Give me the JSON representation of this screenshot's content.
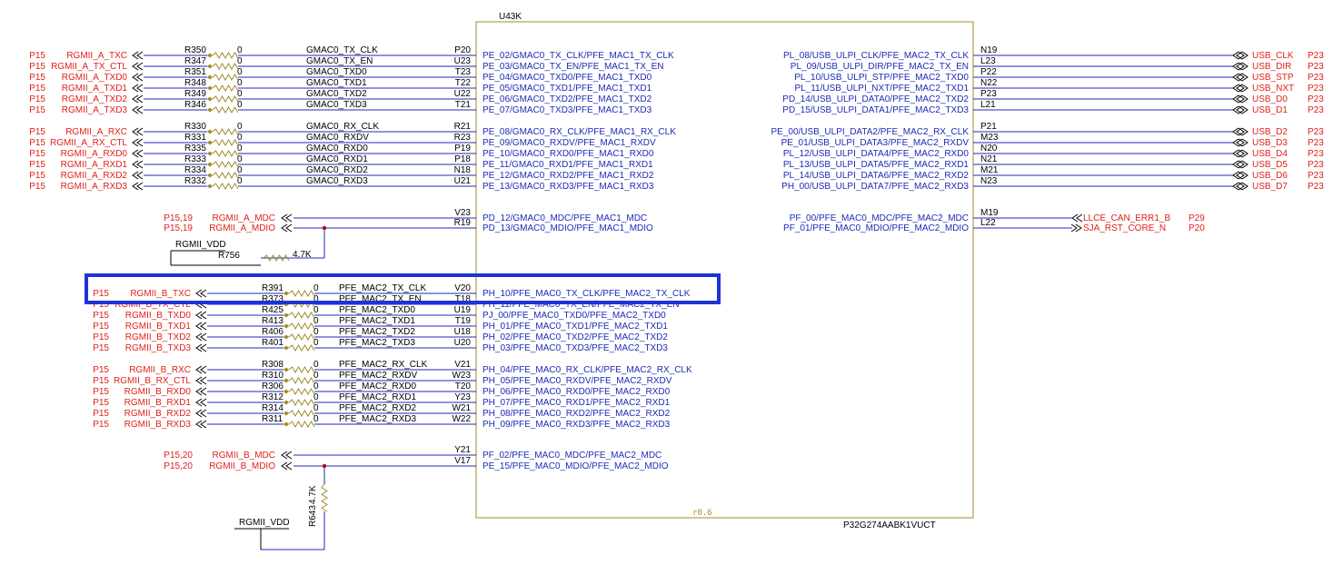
{
  "chip": {
    "ref": "U43K",
    "part": "P32G274AABK1VUCT",
    "rev": "r0.6"
  },
  "colors": {
    "signal": "#e0201a",
    "pin": "#1c2bb5",
    "wire": "#1c2bb5",
    "highlight": "#1d33d8",
    "resistor": "#a08c2a"
  },
  "groups": {
    "rgmii_a": [
      {
        "page": "P15",
        "port": "RGMII_A_TXC",
        "res": "R350",
        "val": "0",
        "net": "GMAC0_TX_CLK",
        "pin": "P20",
        "func": "PE_02/GMAC0_TX_CLK/PFE_MAC1_TX_CLK"
      },
      {
        "page": "P15",
        "port": "RGMII_A_TX_CTL",
        "res": "R347",
        "val": "0",
        "net": "GMAC0_TX_EN",
        "pin": "U23",
        "func": "PE_03/GMAC0_TX_EN/PFE_MAC1_TX_EN"
      },
      {
        "page": "P15",
        "port": "RGMII_A_TXD0",
        "res": "R351",
        "val": "0",
        "net": "GMAC0_TXD0",
        "pin": "T23",
        "func": "PE_04/GMAC0_TXD0/PFE_MAC1_TXD0"
      },
      {
        "page": "P15",
        "port": "RGMII_A_TXD1",
        "res": "R348",
        "val": "0",
        "net": "GMAC0_TXD1",
        "pin": "T22",
        "func": "PE_05/GMAC0_TXD1/PFE_MAC1_TXD1"
      },
      {
        "page": "P15",
        "port": "RGMII_A_TXD2",
        "res": "R349",
        "val": "0",
        "net": "GMAC0_TXD2",
        "pin": "U22",
        "func": "PE_06/GMAC0_TXD2/PFE_MAC1_TXD2"
      },
      {
        "page": "P15",
        "port": "RGMII_A_TXD3",
        "res": "R346",
        "val": "0",
        "net": "GMAC0_TXD3",
        "pin": "T21",
        "func": "PE_07/GMAC0_TXD3/PFE_MAC1_TXD3"
      },
      {
        "page": "P15",
        "port": "RGMII_A_RXC",
        "res": "R330",
        "val": "0",
        "net": "GMAC0_RX_CLK",
        "pin": "R21",
        "func": "PE_08/GMAC0_RX_CLK/PFE_MAC1_RX_CLK"
      },
      {
        "page": "P15",
        "port": "RGMII_A_RX_CTL",
        "res": "R331",
        "val": "0",
        "net": "GMAC0_RXDV",
        "pin": "R23",
        "func": "PE_09/GMAC0_RXDV/PFE_MAC1_RXDV"
      },
      {
        "page": "P15",
        "port": "RGMII_A_RXD0",
        "res": "R335",
        "val": "0",
        "net": "GMAC0_RXD0",
        "pin": "P19",
        "func": "PE_10/GMAC0_RXD0/PFE_MAC1_RXD0"
      },
      {
        "page": "P15",
        "port": "RGMII_A_RXD1",
        "res": "R333",
        "val": "0",
        "net": "GMAC0_RXD1",
        "pin": "P18",
        "func": "PE_11/GMAC0_RXD1/PFE_MAC1_RXD1"
      },
      {
        "page": "P15",
        "port": "RGMII_A_RXD2",
        "res": "R334",
        "val": "0",
        "net": "GMAC0_RXD2",
        "pin": "N18",
        "func": "PE_12/GMAC0_RXD2/PFE_MAC1_RXD2"
      },
      {
        "page": "P15",
        "port": "RGMII_A_RXD3",
        "res": "R332",
        "val": "0",
        "net": "GMAC0_RXD3",
        "pin": "U21",
        "func": "PE_13/GMAC0_RXD3/PFE_MAC1_RXD3"
      }
    ],
    "mdio_a": [
      {
        "page": "P15,19",
        "port": "RGMII_A_MDC",
        "pin": "V23",
        "func": "PD_12/GMAC0_MDC/PFE_MAC1_MDC"
      },
      {
        "page": "P15,19",
        "port": "RGMII_A_MDIO",
        "pin": "R19",
        "func": "PD_13/GMAC0_MDIO/PFE_MAC1_MDIO"
      }
    ],
    "pullup_a": {
      "rail": "RGMII_VDD",
      "res": "R756",
      "val": "4.7K"
    },
    "rgmii_b": [
      {
        "page": "P15",
        "port": "RGMII_B_TXC",
        "res": "R391",
        "val": "0",
        "net": "PFE_MAC2_TX_CLK",
        "pin": "V20",
        "func": "PH_10/PFE_MAC0_TX_CLK/PFE_MAC2_TX_CLK"
      },
      {
        "page": "P15",
        "port": "RGMII_B_TX_CTL",
        "res": "R373",
        "val": "0",
        "net": "PFE_MAC2_TX_EN",
        "pin": "T18",
        "func": "PH_11/PFE_MAC0_TX_EN/PFE_MAC2_TX_EN"
      },
      {
        "page": "P15",
        "port": "RGMII_B_TXD0",
        "res": "R425",
        "val": "0",
        "net": "PFE_MAC2_TXD0",
        "pin": "U19",
        "func": "PJ_00/PFE_MAC0_TXD0/PFE_MAC2_TXD0"
      },
      {
        "page": "P15",
        "port": "RGMII_B_TXD1",
        "res": "R413",
        "val": "0",
        "net": "PFE_MAC2_TXD1",
        "pin": "T19",
        "func": "PH_01/PFE_MAC0_TXD1/PFE_MAC2_TXD1"
      },
      {
        "page": "P15",
        "port": "RGMII_B_TXD2",
        "res": "R406",
        "val": "0",
        "net": "PFE_MAC2_TXD2",
        "pin": "U18",
        "func": "PH_02/PFE_MAC0_TXD2/PFE_MAC2_TXD2"
      },
      {
        "page": "P15",
        "port": "RGMII_B_TXD3",
        "res": "R401",
        "val": "0",
        "net": "PFE_MAC2_TXD3",
        "pin": "U20",
        "func": "PH_03/PFE_MAC0_TXD3/PFE_MAC2_TXD3"
      },
      {
        "page": "P15",
        "port": "RGMII_B_RXC",
        "res": "R308",
        "val": "0",
        "net": "PFE_MAC2_RX_CLK",
        "pin": "V21",
        "func": "PH_04/PFE_MAC0_RX_CLK/PFE_MAC2_RX_CLK"
      },
      {
        "page": "P15",
        "port": "RGMII_B_RX_CTL",
        "res": "R310",
        "val": "0",
        "net": "PFE_MAC2_RXDV",
        "pin": "W23",
        "func": "PH_05/PFE_MAC0_RXDV/PFE_MAC2_RXDV"
      },
      {
        "page": "P15",
        "port": "RGMII_B_RXD0",
        "res": "R306",
        "val": "0",
        "net": "PFE_MAC2_RXD0",
        "pin": "T20",
        "func": "PH_06/PFE_MAC0_RXD0/PFE_MAC2_RXD0"
      },
      {
        "page": "P15",
        "port": "RGMII_B_RXD1",
        "res": "R312",
        "val": "0",
        "net": "PFE_MAC2_RXD1",
        "pin": "Y23",
        "func": "PH_07/PFE_MAC0_RXD1/PFE_MAC2_RXD1"
      },
      {
        "page": "P15",
        "port": "RGMII_B_RXD2",
        "res": "R314",
        "val": "0",
        "net": "PFE_MAC2_RXD2",
        "pin": "W21",
        "func": "PH_08/PFE_MAC0_RXD2/PFE_MAC2_RXD2"
      },
      {
        "page": "P15",
        "port": "RGMII_B_RXD3",
        "res": "R311",
        "val": "0",
        "net": "PFE_MAC2_RXD3",
        "pin": "W22",
        "func": "PH_09/PFE_MAC0_RXD3/PFE_MAC2_RXD3"
      }
    ],
    "mdio_b": [
      {
        "page": "P15,20",
        "port": "RGMII_B_MDC",
        "pin": "Y21",
        "func": "PF_02/PFE_MAC0_MDC/PFE_MAC2_MDC"
      },
      {
        "page": "P15,20",
        "port": "RGMII_B_MDIO",
        "pin": "V17",
        "func": "PE_15/PFE_MAC0_MDIO/PFE_MAC2_MDIO"
      }
    ],
    "pullup_b": {
      "rail": "RGMII_VDD",
      "res": "R643",
      "val": "4.7K"
    },
    "usb": [
      {
        "func": "PL_08/USB_ULPI_CLK/PFE_MAC2_TX_CLK",
        "pin": "N19",
        "port": "USB_CLK",
        "page": "P23"
      },
      {
        "func": "PL_09/USB_ULPI_DIR/PFE_MAC2_TX_EN",
        "pin": "L23",
        "port": "USB_DIR",
        "page": "P23"
      },
      {
        "func": "PL_10/USB_ULPI_STP/PFE_MAC2_TXD0",
        "pin": "P22",
        "port": "USB_STP",
        "page": "P23"
      },
      {
        "func": "PL_11/USB_ULPI_NXT/PFE_MAC2_TXD1",
        "pin": "N22",
        "port": "USB_NXT",
        "page": "P23"
      },
      {
        "func": "PD_14/USB_ULPI_DATA0/PFE_MAC2_TXD2",
        "pin": "P23",
        "port": "USB_D0",
        "page": "P23"
      },
      {
        "func": "PD_15/USB_ULPI_DATA1/PFE_MAC2_TXD3",
        "pin": "L21",
        "port": "USB_D1",
        "page": "P23"
      },
      {
        "func": "PE_00/USB_ULPI_DATA2/PFE_MAC2_RX_CLK",
        "pin": "P21",
        "port": "USB_D2",
        "page": "P23"
      },
      {
        "func": "PE_01/USB_ULPI_DATA3/PFE_MAC2_RXDV",
        "pin": "M23",
        "port": "USB_D3",
        "page": "P23"
      },
      {
        "func": "PL_12/USB_ULPI_DATA4/PFE_MAC2_RXD0",
        "pin": "N20",
        "port": "USB_D4",
        "page": "P23"
      },
      {
        "func": "PL_13/USB_ULPI_DATA5/PFE_MAC2_RXD1",
        "pin": "N21",
        "port": "USB_D5",
        "page": "P23"
      },
      {
        "func": "PL_14/USB_ULPI_DATA6/PFE_MAC2_RXD2",
        "pin": "M21",
        "port": "USB_D6",
        "page": "P23"
      },
      {
        "func": "PH_00/USB_ULPI_DATA7/PFE_MAC2_RXD3",
        "pin": "N23",
        "port": "USB_D7",
        "page": "P23"
      }
    ],
    "mdc_right": [
      {
        "func": "PF_00/PFE_MAC0_MDC/PFE_MAC2_MDC",
        "pin": "M19",
        "port": "LLCE_CAN_ERR1_B",
        "page": "P29"
      },
      {
        "func": "PF_01/PFE_MAC0_MDIO/PFE_MAC2_MDIO",
        "pin": "L22",
        "port": "SJA_RST_CORE_N",
        "page": "P20"
      }
    ]
  }
}
